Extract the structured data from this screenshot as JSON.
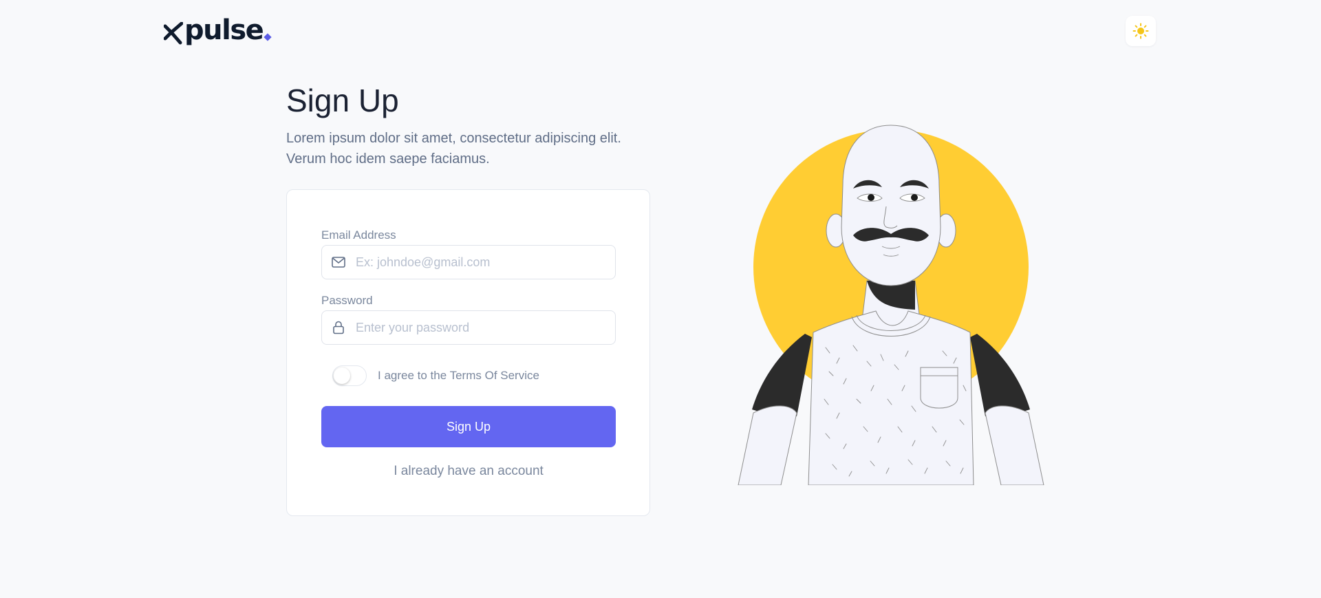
{
  "brand": {
    "logo_text": "pulse",
    "logo_wordmark": "xpulse.",
    "accent_color": "#6366f1"
  },
  "header": {
    "theme_toggle_icon": "sun-icon"
  },
  "main": {
    "title": "Sign Up",
    "subtitle_line1": "Lorem ipsum dolor sit amet, consectetur adipiscing elit.",
    "subtitle_line2": "Verum hoc idem saepe faciamus."
  },
  "form": {
    "email": {
      "label": "Email Address",
      "placeholder": "Ex: johndoe@gmail.com",
      "value": "",
      "icon": "mail-icon"
    },
    "password": {
      "label": "Password",
      "placeholder": "Enter your password",
      "value": "",
      "icon": "lock-icon"
    },
    "terms": {
      "label": "I agree to the Terms Of Service",
      "checked": false
    },
    "submit_label": "Sign Up",
    "alt_link": "I already have an account"
  },
  "colors": {
    "background": "#f8f9fb",
    "button": "#6366f1",
    "illustration_circle": "#ffcd33",
    "sun": "#f5c518"
  }
}
